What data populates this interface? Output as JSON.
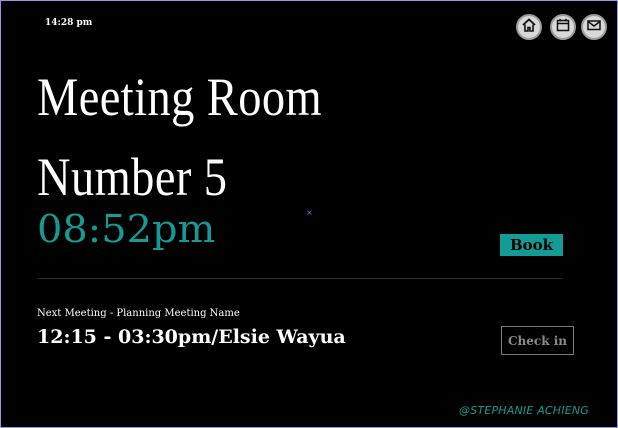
{
  "status_bar": {
    "time": "14:28 pm"
  },
  "nav": {
    "home_icon": "home-icon",
    "calendar_icon": "calendar-icon",
    "mail_icon": "mail-icon"
  },
  "room": {
    "title_line1": "Meeting Room",
    "title_line2": "Number 5",
    "current_time": "08:52pm",
    "book_label": "Book"
  },
  "next_meeting": {
    "label": "Next Meeting - Planning Meeting Name",
    "detail": "12:15 - 03:30pm/Elsie Wayua",
    "checkin_label": "Check in"
  },
  "footer": {
    "credit": "@STEPHANIE ACHIENG"
  },
  "colors": {
    "accent": "#129c95",
    "background": "#000000",
    "text": "#ffffff"
  }
}
